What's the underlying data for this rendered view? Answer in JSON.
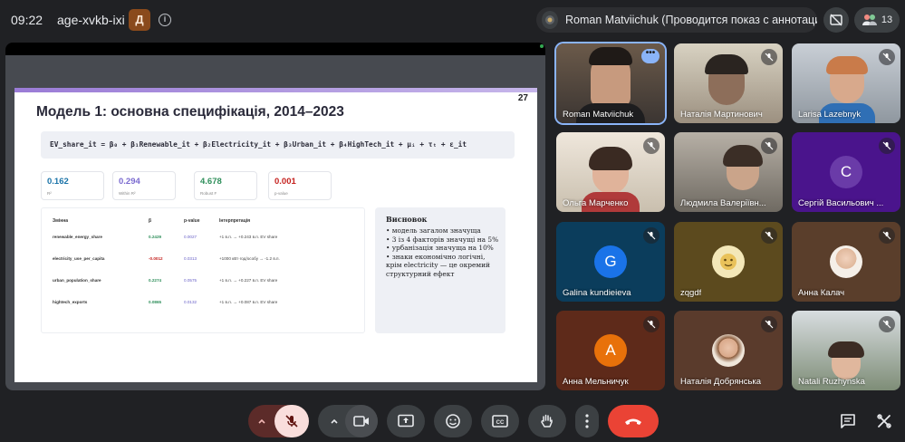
{
  "topbar": {
    "time": "09:22",
    "meeting_code": "age-xvkb-ixi",
    "host_initial": "Д",
    "presenting_text": "Roman Matviichuk (Проводится показ с аннотациями)",
    "participant_count": "13"
  },
  "slide": {
    "number": "27",
    "title": "Модель 1: основна специфікація, 2014–2023",
    "formula": "EV_share_it = β₀ + β₁Renewable_it + β₂Electricity_it + β₃Urban_it + β₄HighTech_it + μᵢ + τₜ + ε_it",
    "stats": [
      {
        "value": "0.162",
        "label": "R²",
        "color": "#1a73a8"
      },
      {
        "value": "0.294",
        "label": "Within R²",
        "color": "#7b6bd0"
      },
      {
        "value": "4.678",
        "label": "Robust F",
        "color": "#2f8f5b"
      },
      {
        "value": "0.001",
        "label": "p-value",
        "color": "#c5221f"
      }
    ],
    "table": {
      "headers": [
        "Змінна",
        "β",
        "p-value",
        "Інтерпретація"
      ],
      "rows": [
        {
          "name": "renewable_energy_share",
          "beta": "0.2429",
          "p": "0.0027",
          "interp": "+1 в.п. → +0.243 в.п. EV share",
          "beta_color": "#2f8f5b"
        },
        {
          "name": "electricity_use_per_capita",
          "beta": "-0.0012",
          "p": "0.0313",
          "interp": "+1000 кВт·год/особу → -1.2 в.п.",
          "beta_color": "#c5221f"
        },
        {
          "name": "urban_population_share",
          "beta": "0.2274",
          "p": "0.0575",
          "interp": "+1 в.п. → +0.227 в.п. EV share",
          "beta_color": "#2f8f5b"
        },
        {
          "name": "hightech_exports",
          "beta": "0.0865",
          "p": "0.0132",
          "interp": "+1 в.п. → +0.087 в.п. EV share",
          "beta_color": "#2f8f5b"
        }
      ]
    },
    "conclusions": {
      "title": "Висновок",
      "items": [
        "• модель загалом значуща",
        "• 3 із 4 факторів значущі на 5%",
        "• урбанізація значуща на 10%",
        "• знаки економічно логічні, крім electricity — це окремий структурний ефект"
      ]
    }
  },
  "participants": [
    {
      "name": "Roman Matviichuk",
      "state": "more",
      "active": true
    },
    {
      "name": "Наталія Мартинович",
      "state": "muted"
    },
    {
      "name": "Larisa Lazebnyk",
      "state": "muted"
    },
    {
      "name": "Ольга Марченко",
      "state": "muted"
    },
    {
      "name": "Людмила Валеріївн...",
      "state": "muted"
    },
    {
      "name": "Сергій Васильович ...",
      "state": "muted",
      "letter": "С",
      "avatar_color": "#5f6368"
    },
    {
      "name": "Galina kundieieva",
      "state": "muted",
      "letter": "G",
      "avatar_color": "#1a73e8"
    },
    {
      "name": "zqgdf",
      "state": "muted"
    },
    {
      "name": "Анна Калач",
      "state": "muted"
    },
    {
      "name": "Анна Мельничук",
      "state": "muted",
      "letter": "А",
      "avatar_color": "#e8710a"
    },
    {
      "name": "Наталія Добрянська",
      "state": "muted"
    },
    {
      "name": "Natali Ruzhynska",
      "state": "muted"
    }
  ],
  "controls": {
    "mic_state": "muted",
    "end_call_color": "#ea4335"
  }
}
